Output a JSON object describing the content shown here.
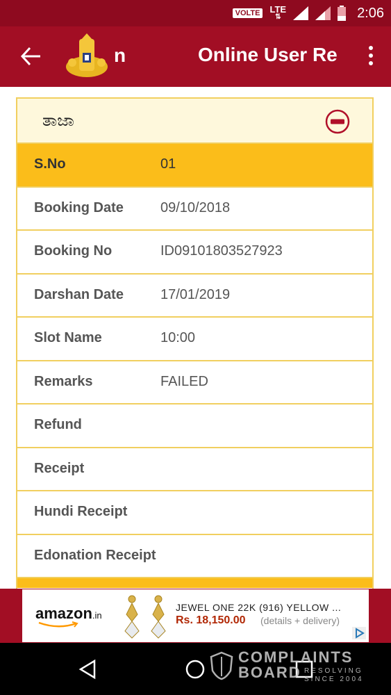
{
  "status_bar": {
    "volte": "VOLTE",
    "network": "LTE",
    "time": "2:06"
  },
  "app_bar": {
    "title": "Online User Re",
    "logo_fragment": "n"
  },
  "card": {
    "header_label": "ತಾಜಾ",
    "rows": [
      {
        "label": "S.No",
        "value": "01"
      },
      {
        "label": "Booking Date",
        "value": "09/10/2018"
      },
      {
        "label": "Booking No",
        "value": "ID09101803527923"
      },
      {
        "label": "Darshan Date",
        "value": "17/01/2019"
      },
      {
        "label": "Slot Name",
        "value": "10:00"
      },
      {
        "label": "Remarks",
        "value": "FAILED"
      },
      {
        "label": "Refund",
        "value": ""
      },
      {
        "label": "Receipt",
        "value": ""
      },
      {
        "label": "Hundi Receipt",
        "value": ""
      },
      {
        "label": "Edonation Receipt",
        "value": ""
      }
    ]
  },
  "ad": {
    "brand": "amazon",
    "brand_suffix": ".in",
    "title": "JEWEL ONE 22K (916) YELLOW ...",
    "price": "Rs. 18,150.00",
    "details": "(details + delivery)"
  },
  "watermark": {
    "line1": "COMPLAINTS",
    "line2": "BOARD",
    "tagline1": "RESOLVING",
    "tagline2": "SINCE 2004"
  },
  "colors": {
    "status_bar": "#8e0a1f",
    "app_bar": "#a20e24",
    "highlight": "#fbbd1a",
    "border": "#f1cf5f",
    "header_bg": "#fef8dc"
  }
}
